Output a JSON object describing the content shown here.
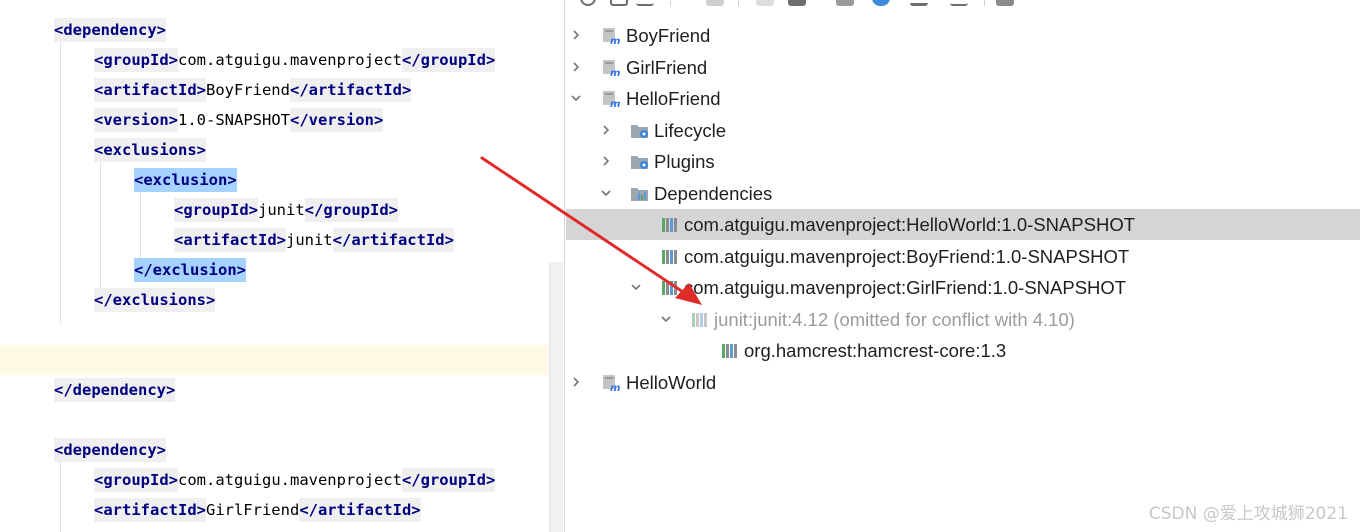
{
  "editor": {
    "lines": [
      {
        "parts": [
          {
            "k": "tag",
            "t": "<dependency>"
          }
        ]
      },
      {
        "parts": [
          {
            "k": "tag",
            "t": "<groupId>"
          },
          {
            "k": "txt",
            "t": "com.atguigu.mavenproject"
          },
          {
            "k": "tag",
            "t": "</groupId>"
          }
        ]
      },
      {
        "parts": [
          {
            "k": "tag",
            "t": "<artifactId>"
          },
          {
            "k": "txt",
            "t": "BoyFriend"
          },
          {
            "k": "tag",
            "t": "</artifactId>"
          }
        ]
      },
      {
        "parts": [
          {
            "k": "tag",
            "t": "<version>"
          },
          {
            "k": "txt",
            "t": "1.0-SNAPSHOT"
          },
          {
            "k": "tag",
            "t": "</version>"
          }
        ]
      },
      {
        "parts": [
          {
            "k": "tag",
            "t": "<exclusions>"
          }
        ]
      },
      {
        "parts": [
          {
            "k": "hl",
            "t": "<exclusion>"
          }
        ]
      },
      {
        "parts": [
          {
            "k": "tag",
            "t": "<groupId>"
          },
          {
            "k": "txt",
            "t": "junit"
          },
          {
            "k": "tag",
            "t": "</groupId>"
          }
        ]
      },
      {
        "parts": [
          {
            "k": "tag",
            "t": "<artifactId>"
          },
          {
            "k": "txt",
            "t": "junit"
          },
          {
            "k": "tag",
            "t": "</artifactId>"
          }
        ]
      },
      {
        "parts": [
          {
            "k": "hl",
            "t": "</exclusion>"
          }
        ]
      },
      {
        "parts": [
          {
            "k": "tag",
            "t": "</exclusions>"
          }
        ]
      },
      {
        "parts": []
      },
      {
        "parts": []
      },
      {
        "parts": [
          {
            "k": "tag",
            "t": "</dependency>"
          }
        ]
      },
      {
        "parts": []
      },
      {
        "parts": [
          {
            "k": "tag",
            "t": "<dependency>"
          }
        ]
      },
      {
        "parts": [
          {
            "k": "tag",
            "t": "<groupId>"
          },
          {
            "k": "txt",
            "t": "com.atguigu.mavenproject"
          },
          {
            "k": "tag",
            "t": "</groupId>"
          }
        ]
      },
      {
        "parts": [
          {
            "k": "tag",
            "t": "<artifactId>"
          },
          {
            "k": "txt",
            "t": "GirlFriend"
          },
          {
            "k": "tag",
            "t": "</artifactId>"
          }
        ]
      }
    ]
  },
  "maven_tree": {
    "nodes": [
      {
        "label": "BoyFriend",
        "icon": "maven-module-icon",
        "expander": "collapsed"
      },
      {
        "label": "GirlFriend",
        "icon": "maven-module-icon",
        "expander": "collapsed"
      },
      {
        "label": "HelloFriend",
        "icon": "maven-module-icon",
        "expander": "expanded"
      },
      {
        "label": "Lifecycle",
        "icon": "lifecycle-folder-icon",
        "expander": "collapsed"
      },
      {
        "label": "Plugins",
        "icon": "plugins-folder-icon",
        "expander": "collapsed"
      },
      {
        "label": "Dependencies",
        "icon": "dependencies-folder-icon",
        "expander": "expanded"
      },
      {
        "label": "com.atguigu.mavenproject:HelloWorld:1.0-SNAPSHOT",
        "icon": "library-icon",
        "expander": "none",
        "selected": true
      },
      {
        "label": "com.atguigu.mavenproject:BoyFriend:1.0-SNAPSHOT",
        "icon": "library-icon",
        "expander": "none"
      },
      {
        "label": "com.atguigu.mavenproject:GirlFriend:1.0-SNAPSHOT",
        "icon": "library-icon",
        "expander": "expanded"
      },
      {
        "label": "junit:junit:4.12 (omitted for conflict with 4.10)",
        "icon": "library-icon",
        "expander": "expanded",
        "dimmed": true
      },
      {
        "label": "org.hamcrest:hamcrest-core:1.3",
        "icon": "library-icon",
        "expander": "none"
      },
      {
        "label": "HelloWorld",
        "icon": "maven-module-icon",
        "expander": "collapsed"
      }
    ]
  },
  "annotation": {
    "arrow_color": "#e02b2b"
  },
  "watermark": "CSDN @爱上攻城狮2021"
}
